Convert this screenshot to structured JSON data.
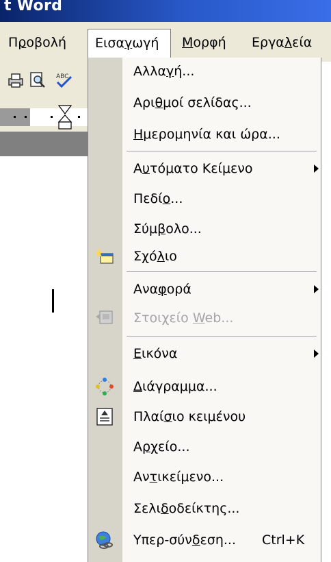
{
  "window": {
    "title_fragment": "t Word"
  },
  "menubar": {
    "items": [
      {
        "label": "Προβολή"
      },
      {
        "label": "Εισαγωγή"
      },
      {
        "label": "Μορφή"
      },
      {
        "label": "Εργαλεία"
      }
    ]
  },
  "insert_menu": {
    "items": [
      {
        "label": "Αλλαγή...",
        "icon": ""
      },
      {
        "label": "Αριθμοί σελίδας...",
        "icon": ""
      },
      {
        "label": "Ημερομηνία και ώρα...",
        "icon": ""
      },
      {
        "label": "Αυτόματο Κείμενο",
        "submenu": true
      },
      {
        "label": "Πεδίο...",
        "icon": ""
      },
      {
        "label": "Σύμβολο...",
        "icon": ""
      },
      {
        "label": "Σχόλιο",
        "icon": "comment-icon"
      },
      {
        "label": "Αναφορά",
        "submenu": true
      },
      {
        "label": "Στοιχείο Web...",
        "icon": "web-component-icon",
        "disabled": true
      },
      {
        "label": "Εικόνα",
        "submenu": true
      },
      {
        "label": "Διάγραμμα...",
        "icon": "diagram-icon"
      },
      {
        "label": "Πλαίσιο κειμένου",
        "icon": "text-box-icon"
      },
      {
        "label": "Αρχείο...",
        "icon": ""
      },
      {
        "label": "Αντικείμενο...",
        "icon": ""
      },
      {
        "label": "Σελιδοδείκτης...",
        "icon": ""
      },
      {
        "label": "Υπερ-σύνδεση...",
        "icon": "hyperlink-icon",
        "shortcut": "Ctrl+K"
      }
    ]
  },
  "toolbar": {
    "icons": [
      "print-icon",
      "print-preview-icon",
      "spelling-icon"
    ]
  }
}
